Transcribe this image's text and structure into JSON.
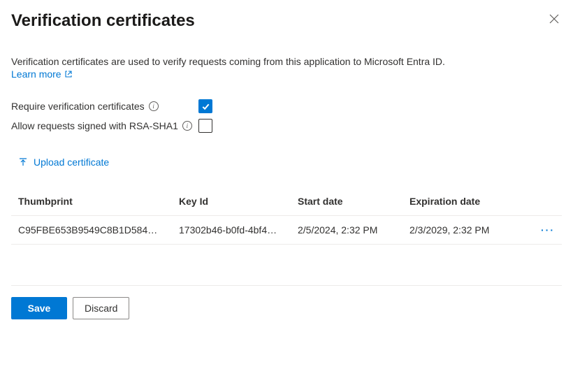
{
  "header": {
    "title": "Verification certificates"
  },
  "description": "Verification certificates are used to verify requests coming from this application to Microsoft Entra ID.",
  "learnMore": "Learn more",
  "options": {
    "requireVerification": {
      "label": "Require verification certificates",
      "checked": true
    },
    "allowRsaSha1": {
      "label": "Allow requests signed with RSA-SHA1",
      "checked": false
    }
  },
  "uploadLabel": "Upload certificate",
  "table": {
    "columns": {
      "thumbprint": "Thumbprint",
      "keyId": "Key Id",
      "startDate": "Start date",
      "expirationDate": "Expiration date"
    },
    "rows": [
      {
        "thumbprint": "C95FBE653B9549C8B1D584…",
        "keyId": "17302b46-b0fd-4bf4…",
        "startDate": "2/5/2024, 2:32 PM",
        "expirationDate": "2/3/2029, 2:32 PM"
      }
    ]
  },
  "footer": {
    "save": "Save",
    "discard": "Discard"
  }
}
